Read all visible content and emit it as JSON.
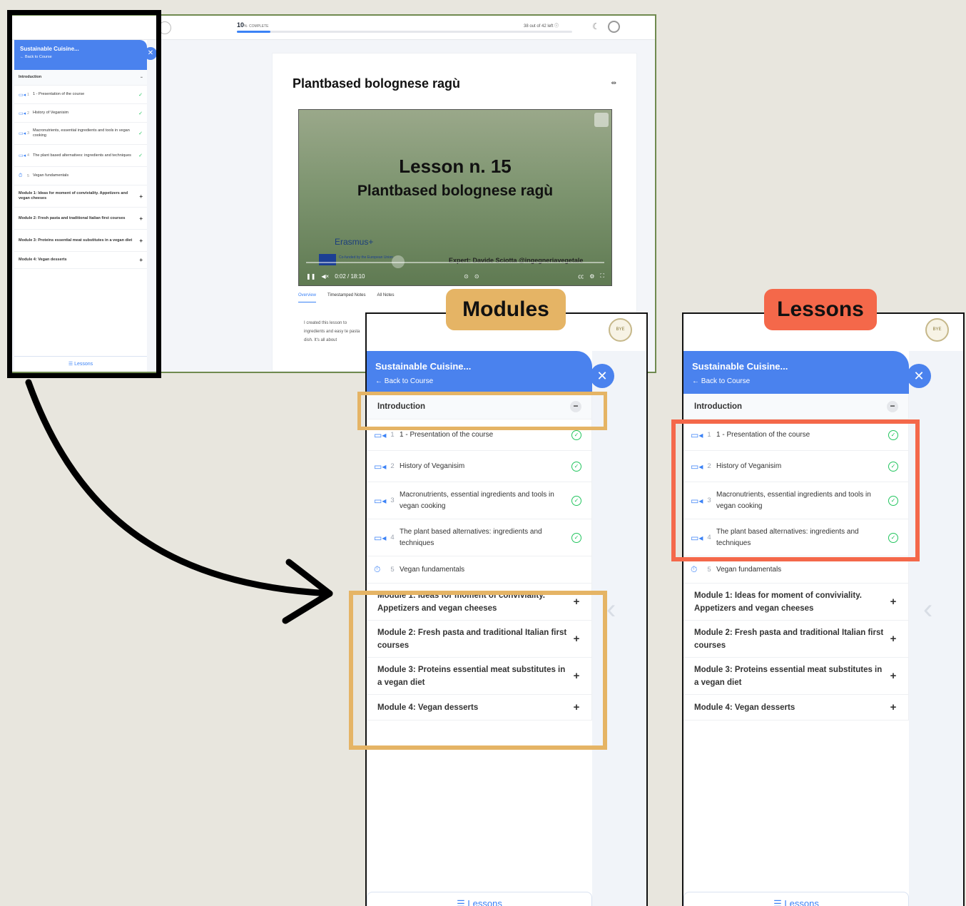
{
  "main_screenshot": {
    "progress": {
      "percent": "10",
      "unit": "%",
      "label": "COMPLETE",
      "fraction": 0.1
    },
    "left_info": "38 out of 42 left",
    "lesson_title": "Plantbased bolognese ragù",
    "video": {
      "line1": "Lesson n. 15",
      "line2": "Plantbased bolognese ragù",
      "erasmus": "Erasmus+",
      "cofunded": "Co-funded by the European Union",
      "expert": "Expert: Davide Sciotta @ingegneriavegetale",
      "time": "0:02 / 18:10"
    },
    "tabs": [
      "Overview",
      "Timestamped Notes",
      "All Notes"
    ],
    "overview_text": "I created this lesson to ingredients and easy te pasta dish. It's all about"
  },
  "sidebar": {
    "course_title": "Sustainable Cuisine...",
    "back_label": "← Back to Course",
    "section_title": "Introduction",
    "lessons": [
      {
        "num": "1",
        "title": "1 - Presentation of the course",
        "icon": "video-icon",
        "done": true
      },
      {
        "num": "2",
        "title": "History of Veganisim",
        "icon": "video-icon",
        "done": true
      },
      {
        "num": "3",
        "title": "Macronutrients, essential ingredients and tools in vegan cooking",
        "icon": "video-icon",
        "done": true
      },
      {
        "num": "4",
        "title": "The plant based alternatives: ingredients and techniques",
        "icon": "video-icon",
        "done": true
      },
      {
        "num": "5",
        "title": "Vegan fundamentals",
        "icon": "timer-icon",
        "done": false
      }
    ],
    "modules": [
      "Module 1: Ideas for moment of conviviality. Appetizers and vegan cheeses",
      "Module 2: Fresh pasta and traditional Italian first courses",
      "Module 3: Proteins essential meat substitutes in a vegan diet",
      "Module 4: Vegan desserts"
    ],
    "lessons_tab": "Lessons"
  },
  "labels": {
    "modules": "Modules",
    "lessons": "Lessons"
  },
  "colors": {
    "accent": "#4a82ee",
    "modules_highlight": "#e5b465",
    "lessons_highlight": "#f4684a",
    "check": "#22c55e"
  }
}
